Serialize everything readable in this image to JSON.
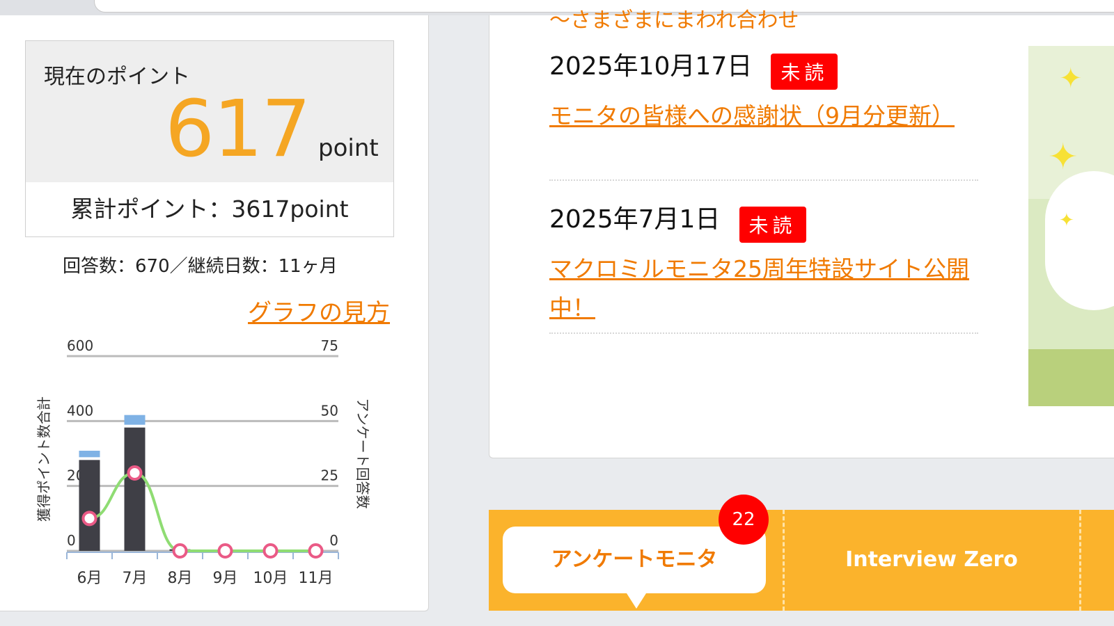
{
  "points": {
    "label": "現在のポイント",
    "current": "617",
    "unit": "point",
    "total_text": "累計ポイント：3617point",
    "answer_text": "回答数：670／継続日数：11ヶ月",
    "graph_link": "グラフの見方"
  },
  "chart_data": {
    "type": "bar",
    "categories": [
      "6月",
      "7月",
      "8月",
      "9月",
      "10月",
      "11月"
    ],
    "ylabel": "獲得ポイント数合計",
    "y2label": "アンケート回答数",
    "ylim": [
      0,
      600
    ],
    "y2lim": [
      0,
      75
    ],
    "yticks": [
      "0",
      "200",
      "400",
      "600"
    ],
    "y2ticks": [
      "0",
      "25",
      "50",
      "75"
    ],
    "series": [
      {
        "type": "bar",
        "axis": "left",
        "values": [
          280,
          380,
          5,
          0,
          0,
          0
        ],
        "color": "#3f3f46"
      },
      {
        "type": "bar",
        "axis": "left",
        "values": [
          20,
          30,
          0,
          0,
          0,
          0
        ],
        "color": "#7fb2e5"
      },
      {
        "type": "line",
        "axis": "right",
        "values": [
          12.5,
          30,
          0,
          0,
          0,
          0
        ],
        "color": "#8fdc73",
        "marker_color": "#ea5a86"
      }
    ]
  },
  "news": {
    "header_cut": "～さまざまにまわれ合わせ",
    "items": [
      {
        "date": "2025年10月17日",
        "badge": "未読",
        "title": "モニタの皆様への感謝状（9月分更新）"
      },
      {
        "date": "2025年7月1日",
        "badge": "未読",
        "title": "マクロミルモニタ25周年特設サイト公開中！"
      }
    ]
  },
  "tabs": {
    "active_label": "アンケートモニタ",
    "badge": "22",
    "second_label": "Interview Zero"
  },
  "colors": {
    "accent": "#f5a623",
    "link": "#f07a00",
    "unread": "#ff0000",
    "tab_bg": "#fbb32c"
  }
}
